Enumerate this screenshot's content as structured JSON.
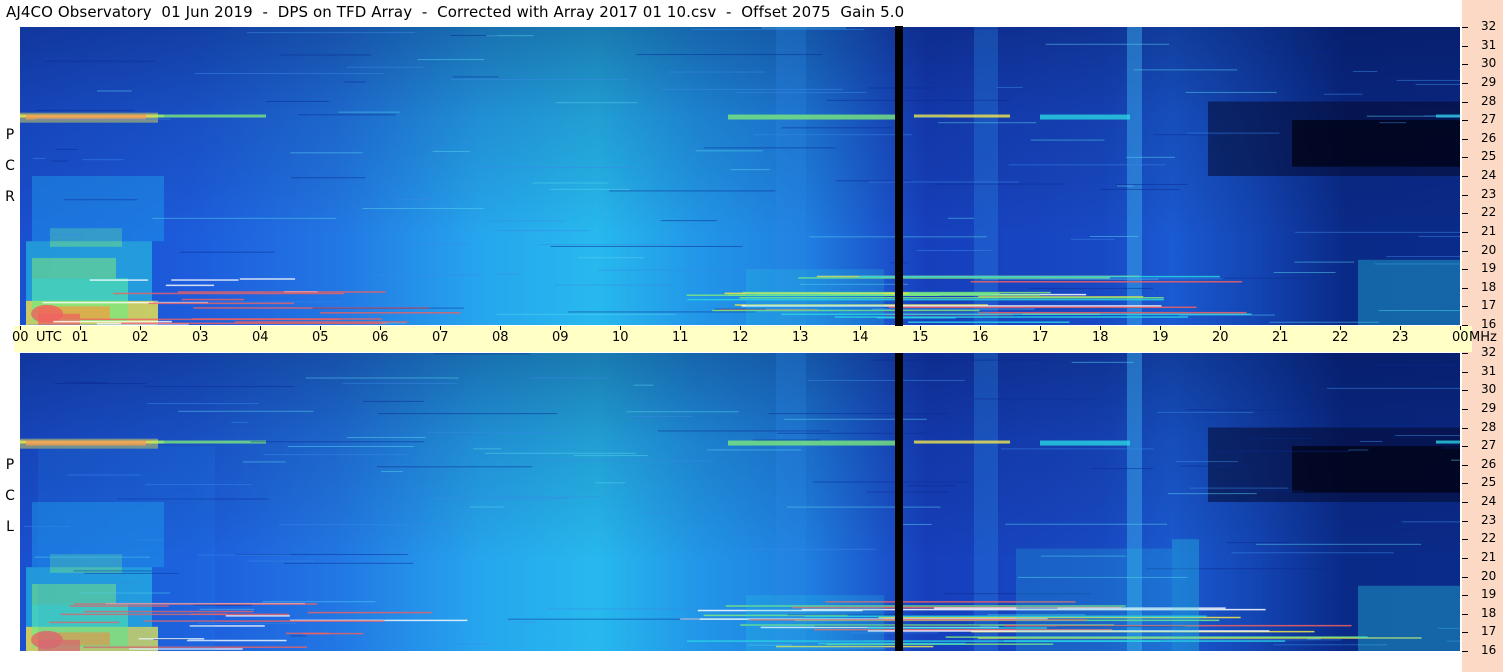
{
  "title": "AJ4CO Observatory  01 Jun 2019  -  DPS on TFD Array  -  Corrected with Array 2017 01 10.csv  -  Offset 2075  Gain 5.0",
  "chart_data": [
    {
      "type": "heatmap",
      "polarization_label": [
        "R",
        "C",
        "P"
      ],
      "x_axis": {
        "unit": "UTC",
        "ticks": [
          "00",
          "01",
          "02",
          "03",
          "04",
          "05",
          "06",
          "07",
          "08",
          "09",
          "10",
          "11",
          "12",
          "13",
          "14",
          "15",
          "16",
          "17",
          "18",
          "19",
          "20",
          "21",
          "22",
          "23",
          "00"
        ],
        "range_hours": [
          0,
          24
        ]
      },
      "y_axis": {
        "unit": "MHz",
        "ticks": [
          "16",
          "17",
          "18",
          "19",
          "20",
          "21",
          "22",
          "23",
          "24",
          "25",
          "26",
          "27",
          "28",
          "29",
          "30",
          "31",
          "32"
        ],
        "range_mhz": [
          16,
          32
        ]
      },
      "data_gap_utc": 14.6,
      "colormap": [
        "#000010",
        "#0a1e8c",
        "#1a56d8",
        "#1fa0ee",
        "#29d3e2",
        "#7be87c",
        "#f2e84a",
        "#f79a3a",
        "#f06060"
      ]
    },
    {
      "type": "heatmap",
      "polarization_label": [
        "L",
        "C",
        "P"
      ],
      "x_axis": {
        "unit": "UTC",
        "ticks": [
          "00",
          "01",
          "02",
          "03",
          "04",
          "05",
          "06",
          "07",
          "08",
          "09",
          "10",
          "11",
          "12",
          "13",
          "14",
          "15",
          "16",
          "17",
          "18",
          "19",
          "20",
          "21",
          "22",
          "23",
          "00"
        ],
        "range_hours": [
          0,
          24
        ]
      },
      "y_axis": {
        "unit": "MHz",
        "ticks": [
          "16",
          "17",
          "18",
          "19",
          "20",
          "21",
          "22",
          "23",
          "24",
          "25",
          "26",
          "27",
          "28",
          "29",
          "30",
          "31",
          "32"
        ],
        "range_mhz": [
          16,
          32
        ]
      },
      "data_gap_utc": 14.6,
      "colormap": [
        "#000010",
        "#0a1e8c",
        "#1a56d8",
        "#1fa0ee",
        "#29d3e2",
        "#7be87c",
        "#f2e84a",
        "#f79a3a",
        "#f06060"
      ]
    }
  ],
  "axis_text": {
    "utc": "UTC",
    "mhz": "MHz"
  }
}
